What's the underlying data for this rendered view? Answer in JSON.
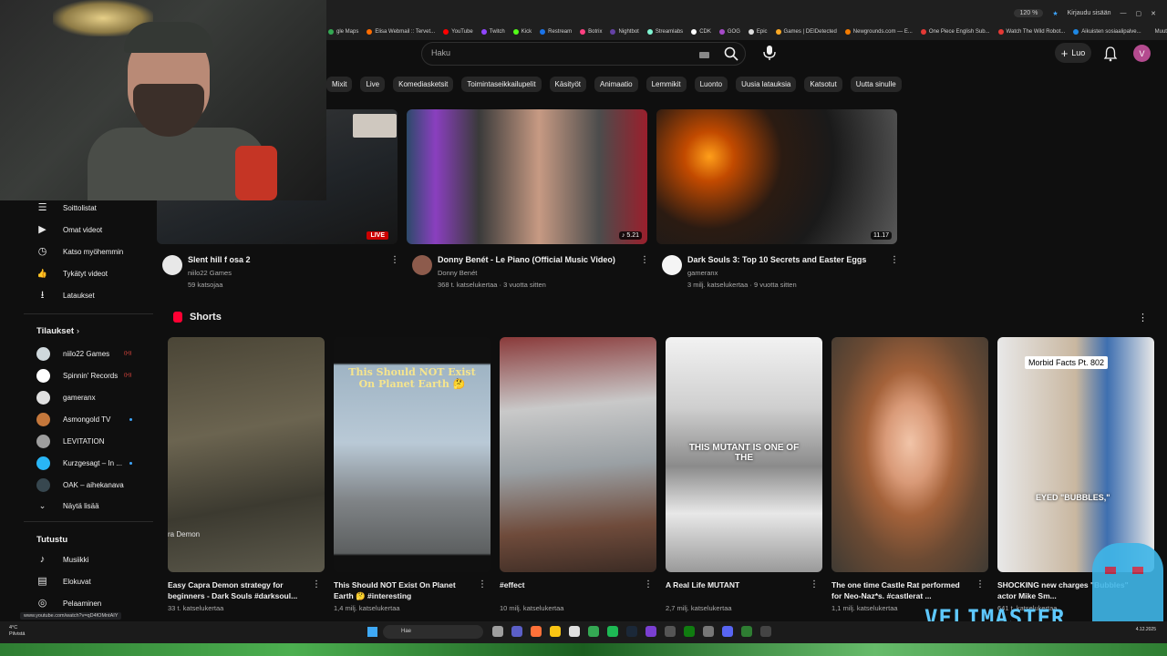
{
  "browser": {
    "zoom": "120 %",
    "signin": "Kirjaudu sisään",
    "bookmarks": [
      {
        "label": "gle Maps",
        "color": "#34a853"
      },
      {
        "label": "Elisa Webmail :: Tervet...",
        "color": "#ff6d00"
      },
      {
        "label": "YouTube",
        "color": "#ff0000"
      },
      {
        "label": "Twitch",
        "color": "#9146ff"
      },
      {
        "label": "Kick",
        "color": "#53fc18"
      },
      {
        "label": "Restream",
        "color": "#1a73e8"
      },
      {
        "label": "Botrix",
        "color": "#ff4081"
      },
      {
        "label": "Nightbot",
        "color": "#6441a5"
      },
      {
        "label": "Streamlabs",
        "color": "#80f5d2"
      },
      {
        "label": "CDK",
        "color": "#ffffff"
      },
      {
        "label": "GOG",
        "color": "#a64ac9"
      },
      {
        "label": "Epic",
        "color": "#dddddd"
      },
      {
        "label": "Games | DEIDetected",
        "color": "#f9a825"
      },
      {
        "label": "Newgrounds.com — E...",
        "color": "#f57c00"
      },
      {
        "label": "One Piece English Sub...",
        "color": "#e53935"
      },
      {
        "label": "Watch The Wild Robot...",
        "color": "#e53935"
      },
      {
        "label": "Aikuisten sosiaalipalve...",
        "color": "#1e88e5"
      }
    ],
    "bookmarks_more": "Muut kirjanmerkit"
  },
  "masthead": {
    "search_placeholder": "Haku",
    "create_label": "Luo",
    "avatar_letter": "V"
  },
  "chips": [
    "Mixit",
    "Live",
    "Komediasketsit",
    "Toimintaseikkailupelit",
    "Käsityöt",
    "Animaatio",
    "Lemmikit",
    "Luonto",
    "Uusia latauksia",
    "Katsotut",
    "Uutta sinulle"
  ],
  "sidebar": {
    "you_items": [
      {
        "label": "Soittolistat",
        "icon": "playlist-icon",
        "glyph": "☰"
      },
      {
        "label": "Omat videot",
        "icon": "my-videos-icon",
        "glyph": "▶"
      },
      {
        "label": "Katso myöhemmin",
        "icon": "watch-later-icon",
        "glyph": "◷"
      },
      {
        "label": "Tykätyt videot",
        "icon": "like-icon",
        "glyph": "👍"
      },
      {
        "label": "Lataukset",
        "icon": "download-icon",
        "glyph": "⭳"
      }
    ],
    "subscriptions_title": "Tilaukset",
    "subscriptions": [
      {
        "label": "niilo22 Games",
        "color": "#cfd8dc",
        "status": "live"
      },
      {
        "label": "Spinnin' Records",
        "color": "#ffffff",
        "status": "live"
      },
      {
        "label": "gameranx",
        "color": "#e0e0e0",
        "status": ""
      },
      {
        "label": "Asmongold TV",
        "color": "#c4773b",
        "status": "new"
      },
      {
        "label": "LEVITATION",
        "color": "#9e9e9e",
        "status": ""
      },
      {
        "label": "Kurzgesagt – In ...",
        "color": "#29b6f6",
        "status": "new"
      },
      {
        "label": "OAK – aihekanava",
        "color": "#37474f",
        "status": ""
      }
    ],
    "show_more": "Näytä lisää",
    "explore_title": "Tutustu",
    "explore": [
      {
        "label": "Musiikki",
        "icon": "music-icon",
        "glyph": "♪"
      },
      {
        "label": "Elokuvat",
        "icon": "movies-icon",
        "glyph": "▤"
      },
      {
        "label": "Pelaaminen",
        "icon": "gaming-icon",
        "glyph": "◎"
      }
    ]
  },
  "videos": [
    {
      "title": "Slent hill f osa 2",
      "channel": "niilo22 Games",
      "meta": "59 katsojaa",
      "badge": "LIVE",
      "duration": ""
    },
    {
      "title": "Donny Benét - Le Piano (Official Music Video)",
      "channel": "Donny Benét",
      "meta": "368 t. katselukertaa · 3 vuotta sitten",
      "badge": "",
      "duration": "♪ 5.21"
    },
    {
      "title": "Dark Souls 3: Top 10 Secrets and Easter Eggs",
      "channel": "gameranx",
      "meta": "3 milj. katselukertaa · 9 vuotta sitten",
      "badge": "",
      "duration": "11.17"
    }
  ],
  "shorts_title": "Shorts",
  "shorts": [
    {
      "title": "Easy Capra Demon strategy for beginners - Dark Souls #darksoul...",
      "meta": "33 t. katselukertaa",
      "caption": "ra Demon"
    },
    {
      "title": "This Should NOT Exist On Planet Earth 🤔 #interesting",
      "meta": "1,4 milj. katselukertaa",
      "caption": "This Should NOT Exist On Planet Earth 🤔"
    },
    {
      "title": "#effect",
      "meta": "10 milj. katselukertaa",
      "caption": ""
    },
    {
      "title": "A Real Life MUTANT",
      "meta": "2,7 milj. katselukertaa",
      "caption": "THIS MUTANT IS ONE OF THE"
    },
    {
      "title": "The one time Castle Rat performed for Neo-Naz*s. #castlerat ...",
      "meta": "1,1 milj. katselukertaa",
      "caption": ""
    },
    {
      "title": "SHOCKING new charges \"Bubbles\" actor Mike Sm...",
      "meta": "641 t. katselukertaa",
      "caption": "Morbid Facts Pt. 802",
      "caption2": "EYED \"BUBBLES,\""
    }
  ],
  "statusbar_url": "www.youtube.com/watch?v=qD4fOMntAIY",
  "taskbar": {
    "weather_temp": "4°C",
    "weather_desc": "Pilvistä",
    "search": "Hae",
    "date": "4.12.2025"
  },
  "watermark": "VELIMASTER"
}
